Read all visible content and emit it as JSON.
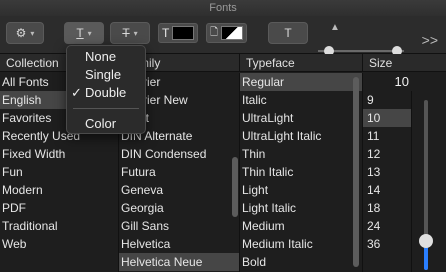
{
  "window": {
    "title": "Fonts"
  },
  "toolbar": {
    "underline_glyph": "T",
    "strike_glyph": "T",
    "text_color_glyph": "T",
    "doc_color_glyph": "",
    "shadow_glyph": "T",
    "overflow_glyph": ">>"
  },
  "menu": {
    "items": [
      "None",
      "Single",
      "Double",
      "Color"
    ],
    "checked": "Double",
    "check_glyph": "✓"
  },
  "headers": {
    "collection": "Collection",
    "family": "Family",
    "typeface": "Typeface",
    "size": "Size"
  },
  "collections": [
    "All Fonts",
    "English",
    "Favorites",
    "Recently Used",
    "Fixed Width",
    "Fun",
    "Modern",
    "PDF",
    "Traditional",
    "Web"
  ],
  "collection_selected": "English",
  "families": [
    "Courier",
    "Courier New",
    "Didot",
    "DIN Alternate",
    "DIN Condensed",
    "Futura",
    "Geneva",
    "Georgia",
    "Gill Sans",
    "Helvetica",
    "Helvetica Neue"
  ],
  "family_selected": "Helvetica Neue",
  "typefaces": [
    "Regular",
    "Italic",
    "UltraLight",
    "UltraLight Italic",
    "Thin",
    "Thin Italic",
    "Light",
    "Light Italic",
    "Medium",
    "Medium Italic",
    "Bold"
  ],
  "typeface_selected": "Regular",
  "size": {
    "value": "10",
    "list": [
      "9",
      "10",
      "11",
      "12",
      "13",
      "14",
      "18",
      "24",
      "36"
    ],
    "selected": "10",
    "slider_fraction": 0.2
  },
  "colors": {
    "accent": "#2a7fff",
    "selection": "#464646"
  }
}
